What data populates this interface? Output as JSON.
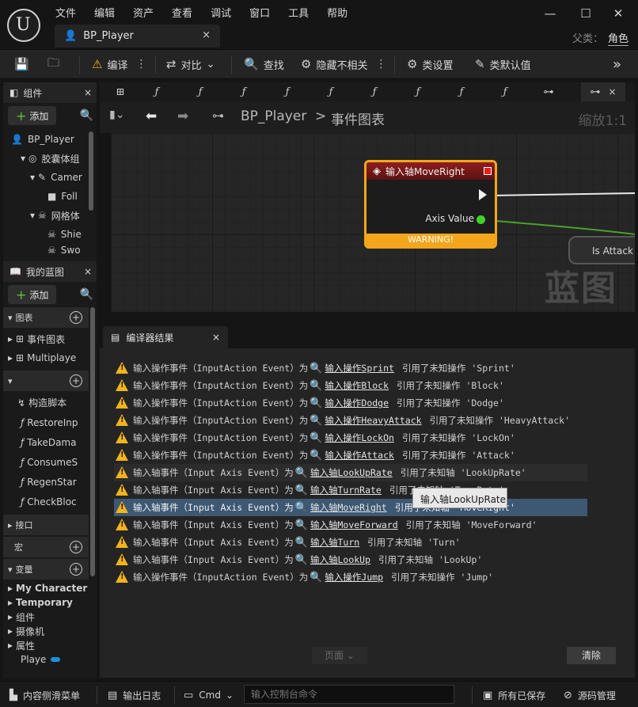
{
  "menu": [
    "文件",
    "编辑",
    "资产",
    "查看",
    "调试",
    "窗口",
    "工具",
    "帮助"
  ],
  "doc_tab": {
    "label": "BP_Player",
    "close": "×"
  },
  "parent_class": {
    "label": "父类：",
    "value": "角色"
  },
  "toolbar": {
    "compile": "编译",
    "diff": "对比",
    "find": "查找",
    "hide_unrelated": "隐藏不相关",
    "class_settings": "类设置",
    "class_defaults": "类默认值"
  },
  "components": {
    "title": "组件",
    "add": "添加",
    "items": [
      "BP_Player",
      "胶囊体组",
      "Camer",
      "Foll",
      "网格体",
      "Shie",
      "Swo"
    ]
  },
  "my_blueprint": {
    "title": "我的蓝图",
    "add": "添加",
    "graphs_section": "图表",
    "graphs": [
      "事件图表",
      "Multiplaye"
    ],
    "functions": [
      "构造脚本",
      "RestoreInp",
      "TakeDama",
      "ConsumeS",
      "RegenStar",
      "CheckBloc"
    ],
    "interfaces_section": "接口",
    "macros_section": "宏",
    "variables_section": "变量",
    "variable_categories": [
      "My Character",
      "Temporary",
      "组件",
      "摄像机",
      "属性",
      "Playe"
    ]
  },
  "graph": {
    "breadcrumb_root": "BP_Player",
    "breadcrumb_sep": ">",
    "breadcrumb_graph": "事件图表",
    "zoom": "缩放1:1",
    "watermark": "蓝图",
    "node_title": "输入轴MoveRight",
    "node_pin": "Axis Value",
    "node_warning": "WARNING!",
    "next_node": "Is Attack"
  },
  "compiler": {
    "tab_title": "编译器结果",
    "rows": [
      {
        "pre": "输入操作事件（InputAction Event）为",
        "link": "输入操作Sprint",
        "post": "引用了未知操作 'Sprint'"
      },
      {
        "pre": "输入操作事件（InputAction Event）为",
        "link": "输入操作Block",
        "post": "引用了未知操作 'Block'"
      },
      {
        "pre": "输入操作事件（InputAction Event）为",
        "link": "输入操作Dodge",
        "post": "引用了未知操作 'Dodge'"
      },
      {
        "pre": "输入操作事件（InputAction Event）为",
        "link": "输入操作HeavyAttack",
        "post": "引用了未知操作 'HeavyAttack'"
      },
      {
        "pre": "输入操作事件（InputAction Event）为",
        "link": "输入操作LockOn",
        "post": "引用了未知操作 'LockOn'"
      },
      {
        "pre": "输入操作事件（InputAction Event）为",
        "link": "输入操作Attack",
        "post": "引用了未知操作 'Attack'"
      },
      {
        "pre": "输入轴事件（Input Axis Event）为",
        "link": "输入轴LookUpRate",
        "post": "引用了未知轴 'LookUpRate'"
      },
      {
        "pre": "输入轴事件（Input Axis Event）为",
        "link": "输入轴TurnRate",
        "post": "引用了未知轴 'TurnRate'"
      },
      {
        "pre": "输入轴事件（Input Axis Event）为",
        "link": "输入轴MoveRight",
        "post": "引用了未知轴 'MoveRight'"
      },
      {
        "pre": "输入轴事件（Input Axis Event）为",
        "link": "输入轴MoveForward",
        "post": "引用了未知轴 'MoveForward'"
      },
      {
        "pre": "输入轴事件（Input Axis Event）为",
        "link": "输入轴Turn",
        "post": "引用了未知轴 'Turn'"
      },
      {
        "pre": "输入轴事件（Input Axis Event）为",
        "link": "输入轴LookUp",
        "post": "引用了未知轴 'LookUp'"
      },
      {
        "pre": "输入操作事件（InputAction Event）为",
        "link": "输入操作Jump",
        "post": "引用了未知操作 'Jump'"
      }
    ],
    "tooltip": "输入轴LookUpRate",
    "page": "页面",
    "clear": "清除"
  },
  "statusbar": {
    "content_drawer": "内容侧滑菜单",
    "output_log": "输出日志",
    "cmd": "Cmd",
    "cmd_placeholder": "输入控制台命令",
    "all_saved": "所有已保存",
    "source_control": "源码管理"
  },
  "colors": {
    "warning": "#f3b31c",
    "node_border": "#f3a61c",
    "selection": "#3d5873",
    "add_plus": "#5fbf3f",
    "tab_icon": "#4a8fe0"
  }
}
